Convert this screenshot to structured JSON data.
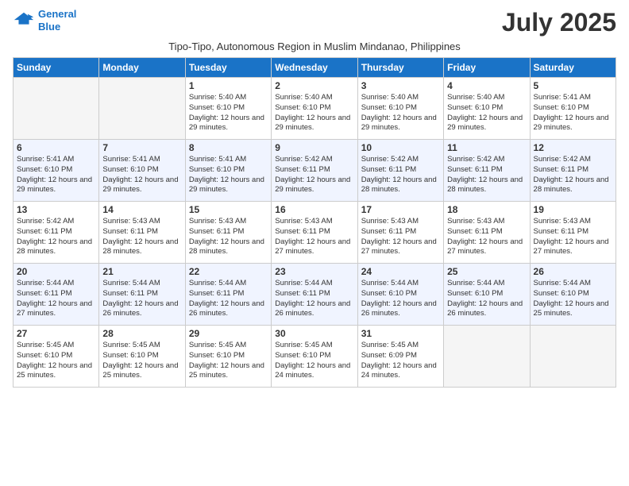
{
  "logo": {
    "line1": "General",
    "line2": "Blue"
  },
  "title": "July 2025",
  "subtitle": "Tipo-Tipo, Autonomous Region in Muslim Mindanao, Philippines",
  "days_of_week": [
    "Sunday",
    "Monday",
    "Tuesday",
    "Wednesday",
    "Thursday",
    "Friday",
    "Saturday"
  ],
  "weeks": [
    [
      {
        "day": "",
        "info": ""
      },
      {
        "day": "",
        "info": ""
      },
      {
        "day": "1",
        "info": "Sunrise: 5:40 AM\nSunset: 6:10 PM\nDaylight: 12 hours and 29 minutes."
      },
      {
        "day": "2",
        "info": "Sunrise: 5:40 AM\nSunset: 6:10 PM\nDaylight: 12 hours and 29 minutes."
      },
      {
        "day": "3",
        "info": "Sunrise: 5:40 AM\nSunset: 6:10 PM\nDaylight: 12 hours and 29 minutes."
      },
      {
        "day": "4",
        "info": "Sunrise: 5:40 AM\nSunset: 6:10 PM\nDaylight: 12 hours and 29 minutes."
      },
      {
        "day": "5",
        "info": "Sunrise: 5:41 AM\nSunset: 6:10 PM\nDaylight: 12 hours and 29 minutes."
      }
    ],
    [
      {
        "day": "6",
        "info": "Sunrise: 5:41 AM\nSunset: 6:10 PM\nDaylight: 12 hours and 29 minutes."
      },
      {
        "day": "7",
        "info": "Sunrise: 5:41 AM\nSunset: 6:10 PM\nDaylight: 12 hours and 29 minutes."
      },
      {
        "day": "8",
        "info": "Sunrise: 5:41 AM\nSunset: 6:10 PM\nDaylight: 12 hours and 29 minutes."
      },
      {
        "day": "9",
        "info": "Sunrise: 5:42 AM\nSunset: 6:11 PM\nDaylight: 12 hours and 29 minutes."
      },
      {
        "day": "10",
        "info": "Sunrise: 5:42 AM\nSunset: 6:11 PM\nDaylight: 12 hours and 28 minutes."
      },
      {
        "day": "11",
        "info": "Sunrise: 5:42 AM\nSunset: 6:11 PM\nDaylight: 12 hours and 28 minutes."
      },
      {
        "day": "12",
        "info": "Sunrise: 5:42 AM\nSunset: 6:11 PM\nDaylight: 12 hours and 28 minutes."
      }
    ],
    [
      {
        "day": "13",
        "info": "Sunrise: 5:42 AM\nSunset: 6:11 PM\nDaylight: 12 hours and 28 minutes."
      },
      {
        "day": "14",
        "info": "Sunrise: 5:43 AM\nSunset: 6:11 PM\nDaylight: 12 hours and 28 minutes."
      },
      {
        "day": "15",
        "info": "Sunrise: 5:43 AM\nSunset: 6:11 PM\nDaylight: 12 hours and 28 minutes."
      },
      {
        "day": "16",
        "info": "Sunrise: 5:43 AM\nSunset: 6:11 PM\nDaylight: 12 hours and 27 minutes."
      },
      {
        "day": "17",
        "info": "Sunrise: 5:43 AM\nSunset: 6:11 PM\nDaylight: 12 hours and 27 minutes."
      },
      {
        "day": "18",
        "info": "Sunrise: 5:43 AM\nSunset: 6:11 PM\nDaylight: 12 hours and 27 minutes."
      },
      {
        "day": "19",
        "info": "Sunrise: 5:43 AM\nSunset: 6:11 PM\nDaylight: 12 hours and 27 minutes."
      }
    ],
    [
      {
        "day": "20",
        "info": "Sunrise: 5:44 AM\nSunset: 6:11 PM\nDaylight: 12 hours and 27 minutes."
      },
      {
        "day": "21",
        "info": "Sunrise: 5:44 AM\nSunset: 6:11 PM\nDaylight: 12 hours and 26 minutes."
      },
      {
        "day": "22",
        "info": "Sunrise: 5:44 AM\nSunset: 6:11 PM\nDaylight: 12 hours and 26 minutes."
      },
      {
        "day": "23",
        "info": "Sunrise: 5:44 AM\nSunset: 6:11 PM\nDaylight: 12 hours and 26 minutes."
      },
      {
        "day": "24",
        "info": "Sunrise: 5:44 AM\nSunset: 6:10 PM\nDaylight: 12 hours and 26 minutes."
      },
      {
        "day": "25",
        "info": "Sunrise: 5:44 AM\nSunset: 6:10 PM\nDaylight: 12 hours and 26 minutes."
      },
      {
        "day": "26",
        "info": "Sunrise: 5:44 AM\nSunset: 6:10 PM\nDaylight: 12 hours and 25 minutes."
      }
    ],
    [
      {
        "day": "27",
        "info": "Sunrise: 5:45 AM\nSunset: 6:10 PM\nDaylight: 12 hours and 25 minutes."
      },
      {
        "day": "28",
        "info": "Sunrise: 5:45 AM\nSunset: 6:10 PM\nDaylight: 12 hours and 25 minutes."
      },
      {
        "day": "29",
        "info": "Sunrise: 5:45 AM\nSunset: 6:10 PM\nDaylight: 12 hours and 25 minutes."
      },
      {
        "day": "30",
        "info": "Sunrise: 5:45 AM\nSunset: 6:10 PM\nDaylight: 12 hours and 24 minutes."
      },
      {
        "day": "31",
        "info": "Sunrise: 5:45 AM\nSunset: 6:09 PM\nDaylight: 12 hours and 24 minutes."
      },
      {
        "day": "",
        "info": ""
      },
      {
        "day": "",
        "info": ""
      }
    ]
  ]
}
